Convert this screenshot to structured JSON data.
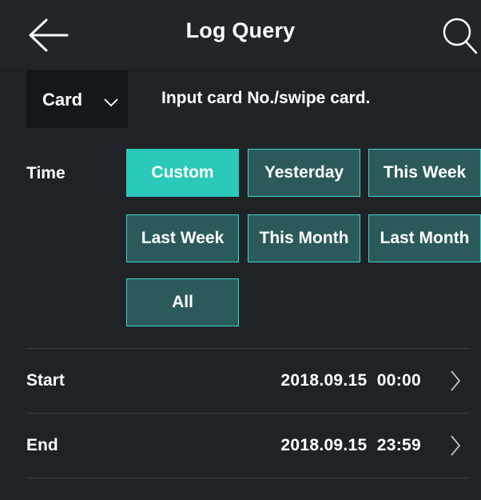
{
  "header": {
    "title": "Log Query",
    "back_icon": "arrow-left-icon",
    "search_icon": "search-icon"
  },
  "filter": {
    "type_selected": "Card",
    "type_icon": "chevron-down-icon",
    "input_placeholder": "Input card No./swipe card."
  },
  "time": {
    "label": "Time",
    "options": [
      "Custom",
      "Yesterday",
      "This Week",
      "Last Week",
      "This Month",
      "Last Month",
      "All"
    ],
    "selected": "Custom"
  },
  "range": {
    "start": {
      "label": "Start",
      "value": "2018.09.15  00:00"
    },
    "end": {
      "label": "End",
      "value": "2018.09.15  23:59"
    }
  },
  "colors": {
    "background": "#1f2328",
    "accent": "#2bc9b9",
    "button_fill": "#2c5a5a",
    "button_border": "#3fd3c5"
  }
}
